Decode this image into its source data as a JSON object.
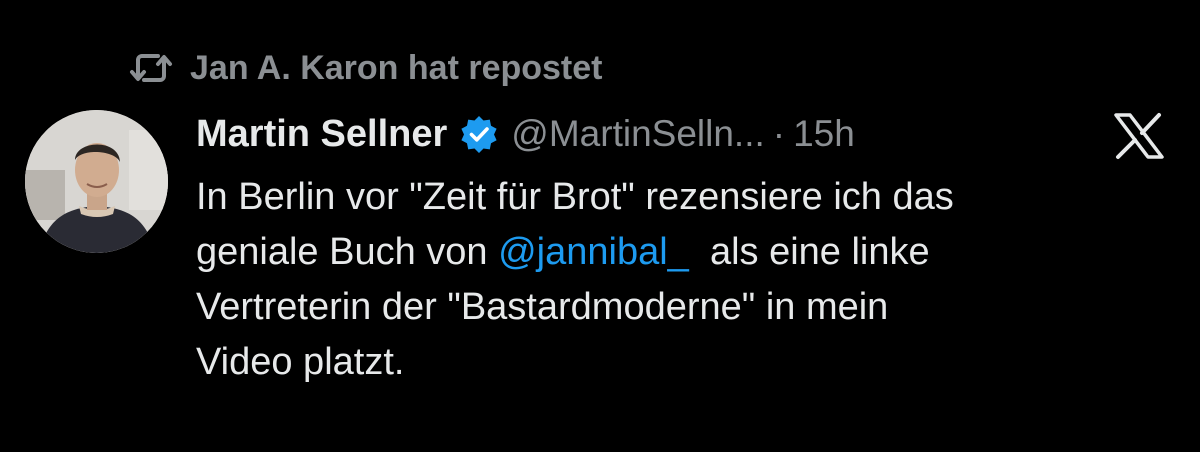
{
  "repost": {
    "text": "Jan A. Karon hat repostet",
    "icon": "repost-icon"
  },
  "author": {
    "name": "Martin Sellner",
    "verified_icon": "verified-badge-icon",
    "handle": "@MartinSelln...",
    "separator": "·",
    "time": "15h"
  },
  "platform_icon": "x-logo-icon",
  "tweet": {
    "line1": "In Berlin vor \"Zeit für Brot\" rezensiere ich das",
    "line2_start": "geniale Buch von ",
    "mention": "@jannibal_",
    "line2_end": "  als eine linke",
    "line3": "Vertreterin der \"Bastardmoderne\" in mein",
    "line4": "Video platzt."
  },
  "colors": {
    "background": "#000000",
    "text": "#e7e9ea",
    "muted": "#8b8f93",
    "accent": "#1d9bf0"
  }
}
